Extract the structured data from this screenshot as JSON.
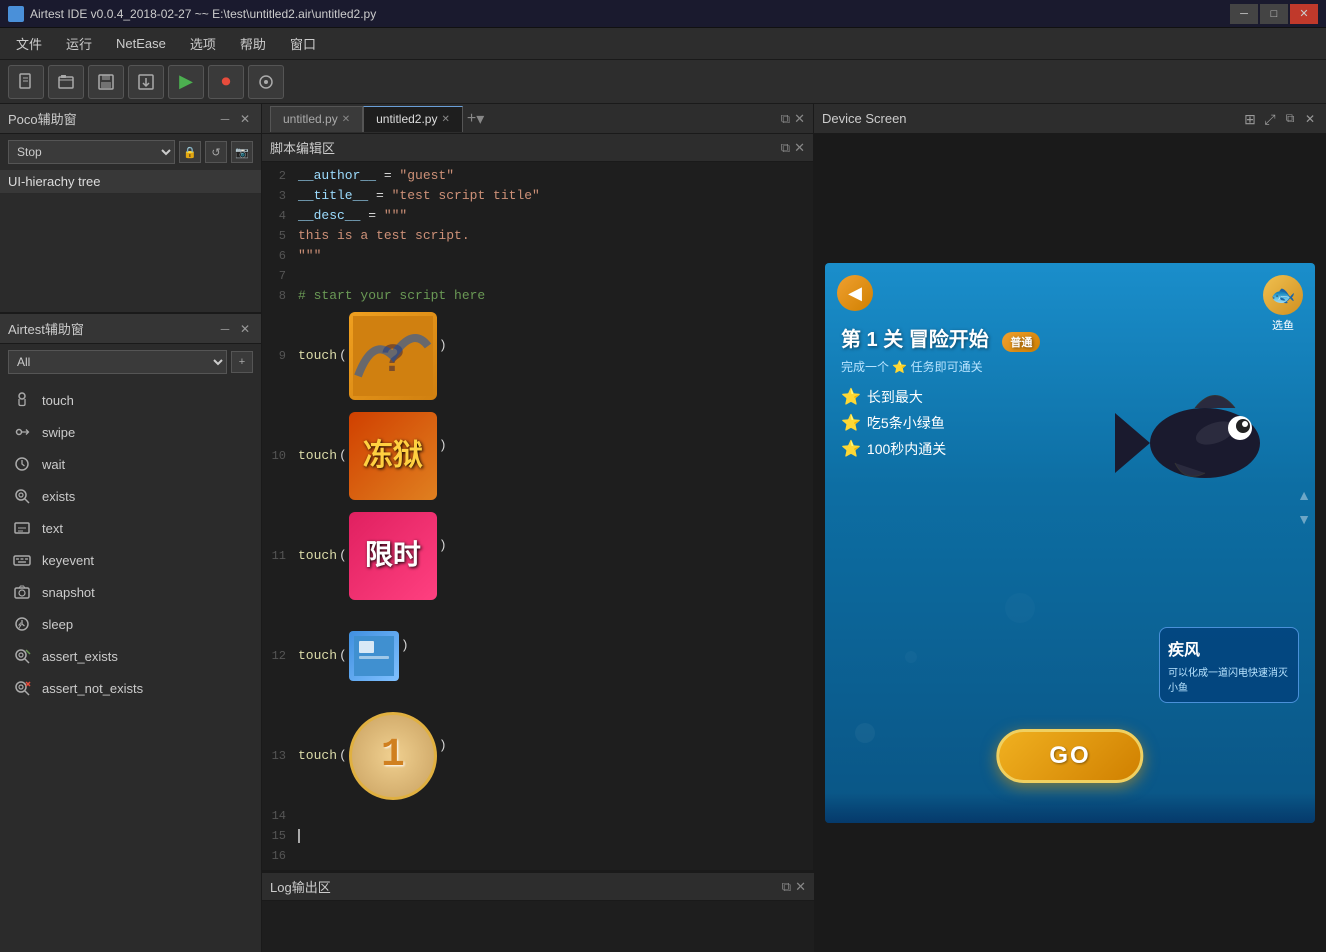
{
  "titlebar": {
    "title": "Airtest IDE v0.0.4_2018-02-27 ~~ E:\\test\\untitled2.air\\untitled2.py",
    "icon": "A",
    "win_minimize": "─",
    "win_maximize": "□",
    "win_close": "✕"
  },
  "menubar": {
    "items": [
      "文件",
      "运行",
      "NetEase",
      "选项",
      "帮助",
      "窗口"
    ]
  },
  "toolbar": {
    "buttons": [
      "new-file",
      "open-file",
      "save-file",
      "export-file",
      "play",
      "stop-record",
      "record"
    ]
  },
  "poco_panel": {
    "title": "Poco辅助窗",
    "stop_label": "Stop",
    "ui_hierarchy_label": "UI-hierachy tree"
  },
  "airtest_panel": {
    "title": "Airtest辅助窗",
    "filter_all": "All",
    "items": [
      {
        "icon": "touch",
        "label": "touch"
      },
      {
        "icon": "swipe",
        "label": "swipe"
      },
      {
        "icon": "wait",
        "label": "wait"
      },
      {
        "icon": "exists",
        "label": "exists"
      },
      {
        "icon": "text",
        "label": "text"
      },
      {
        "icon": "keyevent",
        "label": "keyevent"
      },
      {
        "icon": "snapshot",
        "label": "snapshot"
      },
      {
        "icon": "sleep",
        "label": "sleep"
      },
      {
        "icon": "assert_exists",
        "label": "assert_exists"
      },
      {
        "icon": "assert_not_exists",
        "label": "assert_not_exists"
      }
    ]
  },
  "editor": {
    "title": "脚本编辑区",
    "tabs": [
      {
        "label": "untitled.py",
        "active": false
      },
      {
        "label": "untitled2.py",
        "active": true
      }
    ],
    "add_tab_label": "+",
    "lines": [
      {
        "num": 2,
        "content": "__author__ = \"guest\""
      },
      {
        "num": 3,
        "content": "__title__ = \"test script title\""
      },
      {
        "num": 4,
        "content": "__desc__ = \"\"\""
      },
      {
        "num": 5,
        "content": "this is a test script."
      },
      {
        "num": 6,
        "content": "\"\"\""
      },
      {
        "num": 7,
        "content": ""
      },
      {
        "num": 8,
        "content": "# start your script here"
      },
      {
        "num": 9,
        "content": "touch()"
      },
      {
        "num": 10,
        "content": "touch()"
      },
      {
        "num": 11,
        "content": "touch()"
      },
      {
        "num": 12,
        "content": "touch()"
      },
      {
        "num": 13,
        "content": "touch()"
      },
      {
        "num": 14,
        "content": ""
      },
      {
        "num": 15,
        "content": ""
      },
      {
        "num": 16,
        "content": ""
      }
    ]
  },
  "log_panel": {
    "title": "Log输出区"
  },
  "device_panel": {
    "title": "Device Screen"
  },
  "game": {
    "back_arrow": "◀",
    "chapter": "第 1 关 冒险开始",
    "fish_select": "选鱼",
    "normal_badge": "普通",
    "subtitle": "完成一个 ⭐ 任务即可通关",
    "tasks": [
      "长到最大",
      "吃5条小绿鱼",
      "100秒内通关"
    ],
    "fish_name": "疾风",
    "fish_desc": "可以化成一道闪电快速消灭小鱼",
    "go_button": "GO"
  }
}
